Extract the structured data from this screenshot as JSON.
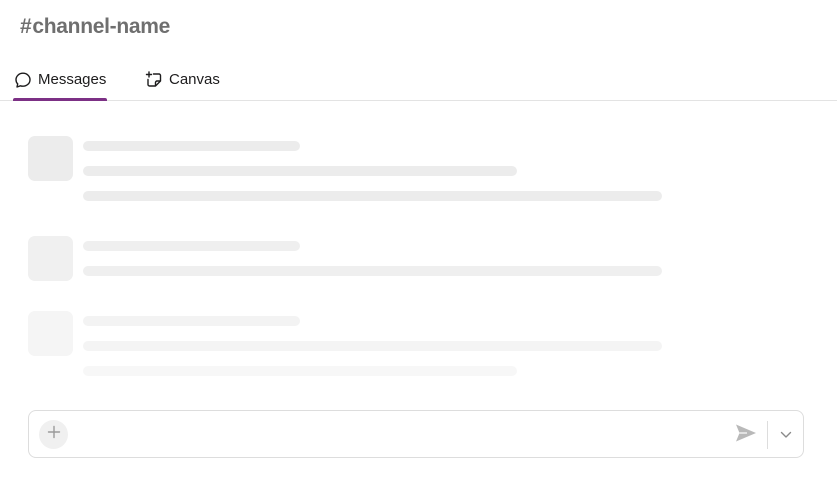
{
  "channel": {
    "hash": "#",
    "name": "channel-name"
  },
  "tabs": [
    {
      "id": "messages",
      "label": "Messages",
      "icon": "message-bubble-icon",
      "active": true
    },
    {
      "id": "canvas",
      "label": "Canvas",
      "icon": "canvas-icon",
      "active": false
    }
  ],
  "colors": {
    "accent": "#7c3085",
    "skeleton": [
      "#ececec",
      "#f0f0f0",
      "#f5f5f5"
    ]
  },
  "composer": {
    "placeholder": "",
    "value": "",
    "icons": [
      "plus-icon",
      "send-icon",
      "chevron-down-icon"
    ]
  }
}
